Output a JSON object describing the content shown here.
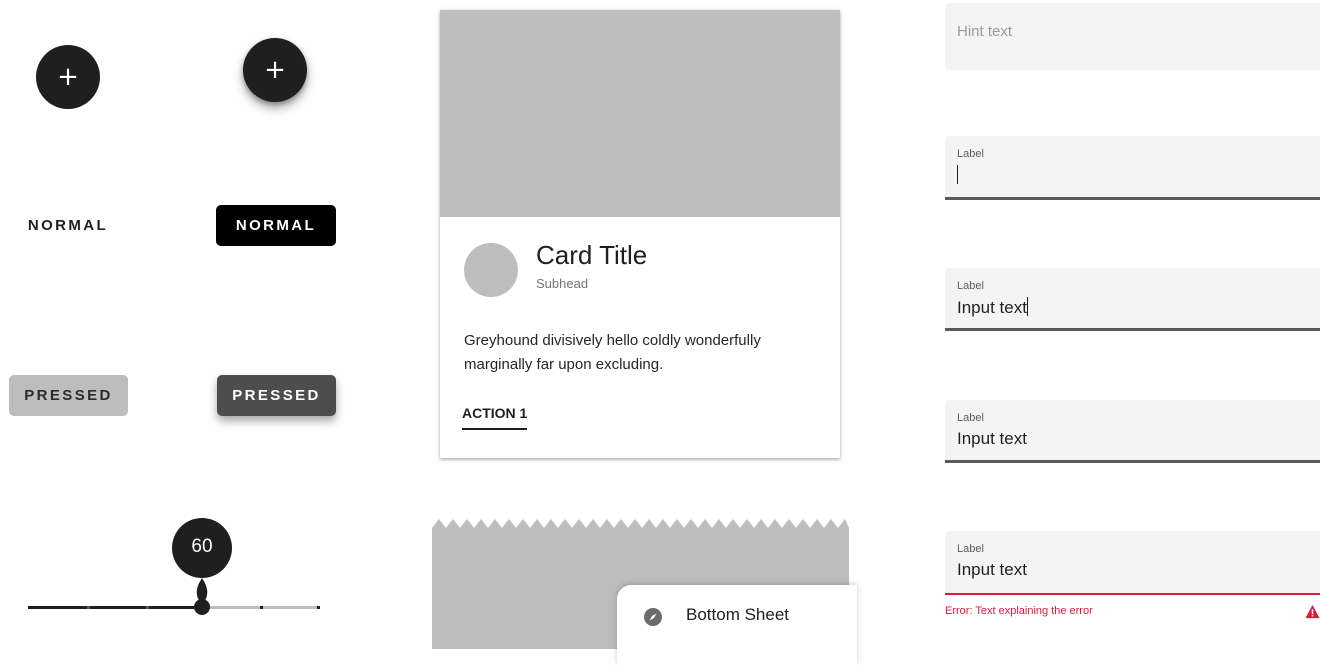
{
  "fabs": [
    {
      "icon": "plus-icon",
      "glyph": "+"
    },
    {
      "icon": "plus-icon",
      "glyph": "+"
    }
  ],
  "buttons": {
    "normal_text": "NORMAL",
    "normal_contained": "NORMAL",
    "pressed_text": "PRESSED",
    "pressed_contained": "PRESSED"
  },
  "slider": {
    "value": "60",
    "fraction": 0.6
  },
  "card": {
    "title": "Card Title",
    "subhead": "Subhead",
    "body": "Greyhound divisively hello coldly wonderfully marginally far upon excluding.",
    "action": "ACTION 1"
  },
  "bottom_sheet": {
    "icon": "compass-icon",
    "label": "Bottom Sheet"
  },
  "fields": {
    "hint": "Hint text",
    "focused_empty": {
      "label": "Label"
    },
    "focused_filled": {
      "label": "Label",
      "value": "Input text"
    },
    "filled": {
      "label": "Label",
      "value": "Input text"
    },
    "error": {
      "label": "Label",
      "value": "Input text",
      "message": "Error: Text explaining the error",
      "icon": "warning-icon"
    }
  },
  "colors": {
    "primary": "#1f1f1f",
    "surface_gray": "#bdbdbd",
    "field_bg": "#f4f4f4",
    "error": "#d81b3a"
  }
}
